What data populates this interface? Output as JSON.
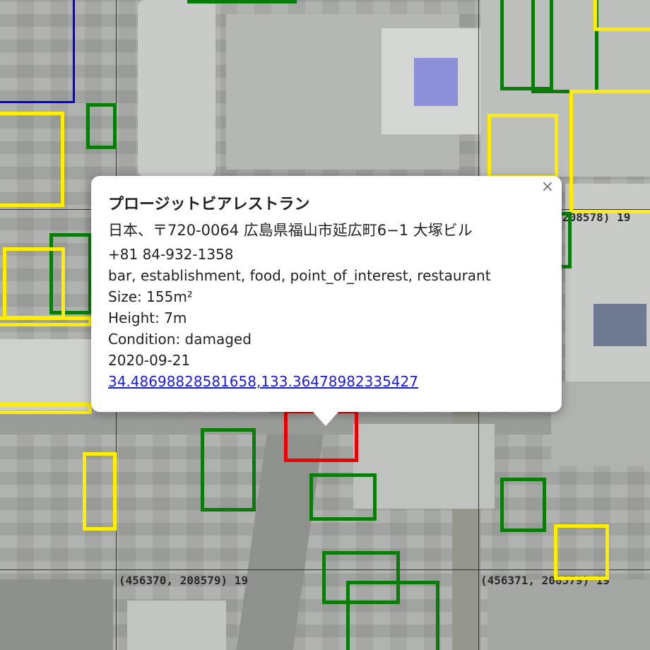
{
  "map": {
    "tile_labels": [
      "208578) 19",
      "(456370, 208579) 19",
      "(456371, 208579) 19"
    ],
    "colors": {
      "green": "#0a7c0a",
      "yellow": "#ffee00",
      "red": "#ee0000",
      "blue": "#0000ee"
    }
  },
  "popup": {
    "title": "プロージットビアレストラン",
    "address": "日本、〒720-0064 広島県福山市延広町6−1 大塚ビル",
    "phone": "+81 84-932-1358",
    "types": "bar, establishment, food, point_of_interest, restaurant",
    "size": "Size: 155m²",
    "height": "Height: 7m",
    "condition": "Condition: damaged",
    "date": "2020-09-21",
    "coordinates": "34.48698828581658,133.36478982335427",
    "close_label": "×"
  }
}
